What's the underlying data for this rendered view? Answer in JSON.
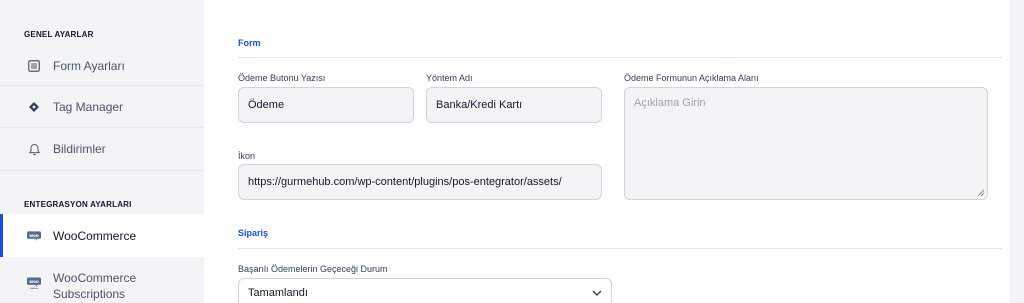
{
  "sidebar": {
    "general_title": "GENEL AYARLAR",
    "general_items": [
      {
        "label": "Form Ayarları",
        "icon": "list-icon"
      },
      {
        "label": "Tag Manager",
        "icon": "diamond-icon"
      },
      {
        "label": "Bildirimler",
        "icon": "bell-icon"
      }
    ],
    "integration_title": "ENTEGRASYON AYARLARI",
    "integration_items": [
      {
        "label": "WooCommerce",
        "icon": "woo-icon",
        "active": true
      },
      {
        "label": "WooCommerce Subscriptions",
        "label_line1": "WooCommerce",
        "label_line2": "Subscriptions",
        "icon": "woo-subs-icon"
      }
    ],
    "colors": {
      "accent": "#1d4ed8"
    }
  },
  "form": {
    "title": "Form",
    "button_text": {
      "label": "Ödeme Butonu Yazısı",
      "value": "Ödeme"
    },
    "method_name": {
      "label": "Yöntem Adı",
      "value": "Banka/Kredi Kartı"
    },
    "description": {
      "label": "Ödeme Formunun Açıklama Alanı",
      "placeholder": "Açıklama Girin"
    },
    "icon": {
      "label": "İkon",
      "value": "https://gurmehub.com/wp-content/plugins/pos-entegrator/assets/"
    }
  },
  "order": {
    "title": "Sipariş",
    "status": {
      "label": "Başarılı Ödemelerin Geçeceği Durum",
      "value": "Tamamlandı"
    }
  }
}
